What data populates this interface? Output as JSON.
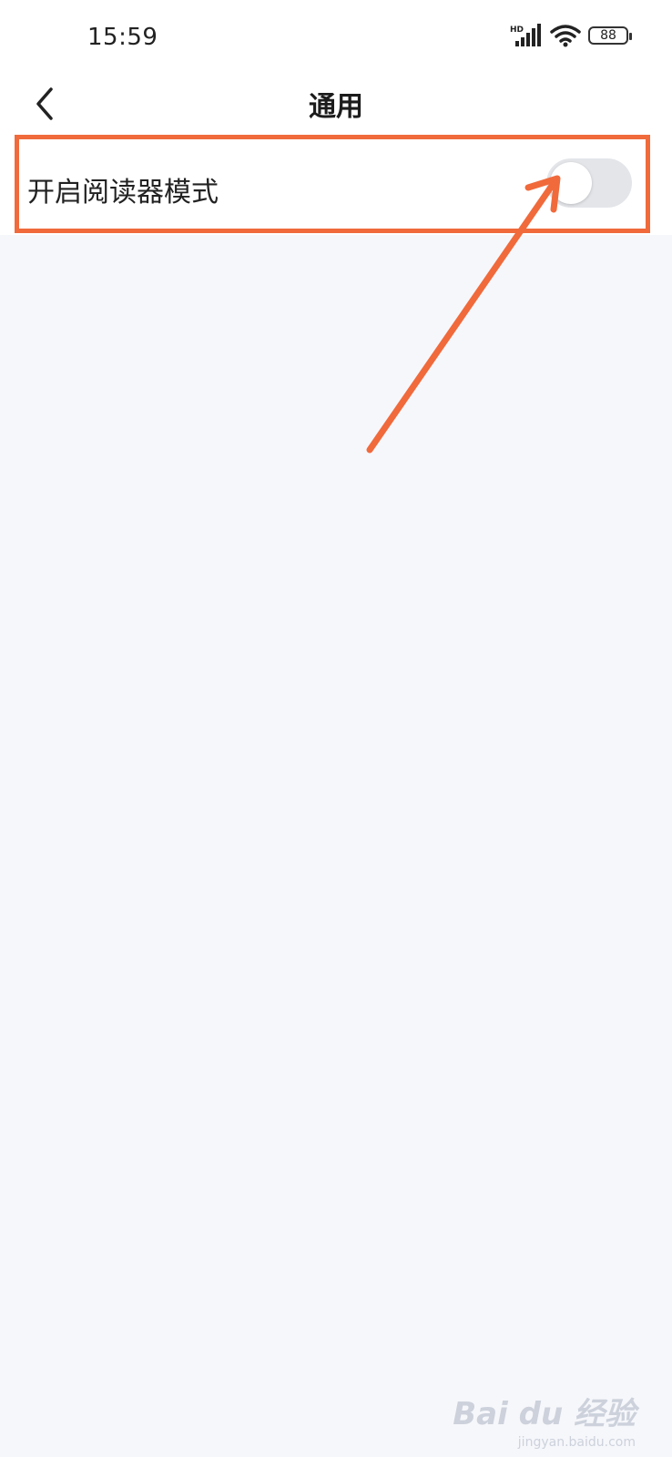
{
  "status_bar": {
    "time": "15:59",
    "network_label": "HD",
    "battery_level": "88",
    "icons": [
      "signal-icon",
      "wifi-icon",
      "battery-icon"
    ]
  },
  "nav": {
    "title": "通用",
    "back_icon": "chevron-left-icon"
  },
  "settings": {
    "reader_mode": {
      "label": "开启阅读器模式",
      "enabled": false
    }
  },
  "annotation": {
    "color": "#f06a3c"
  },
  "watermark": {
    "logo": "Bai du 经验",
    "url": "jingyan.baidu.com"
  },
  "colors": {
    "background": "#f6f7fb",
    "surface": "#ffffff",
    "toggle_off": "#e3e5e9",
    "accent": "#f06a3c"
  }
}
